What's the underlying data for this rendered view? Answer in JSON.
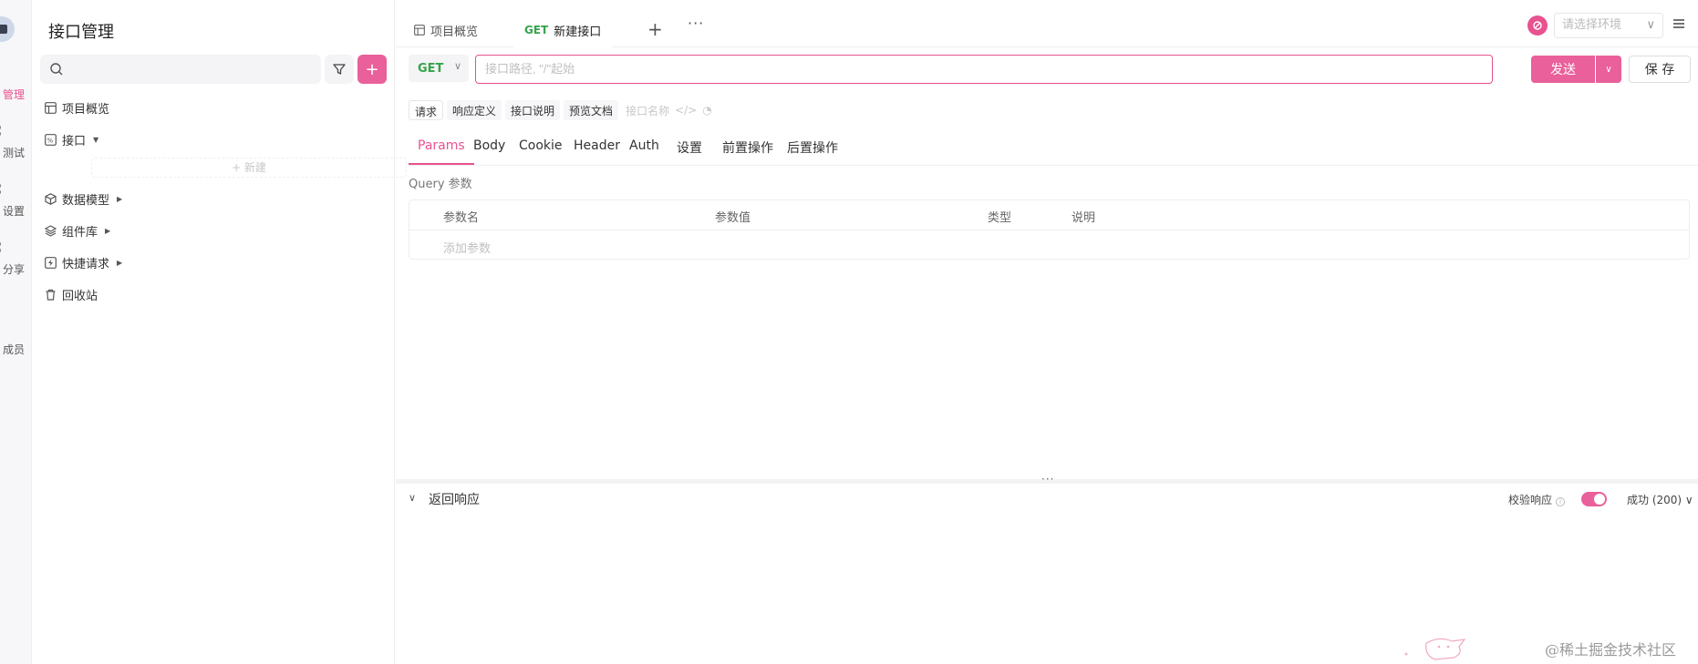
{
  "rail": {
    "items": [
      {
        "label": "管理",
        "icon": "api-icon"
      },
      {
        "label": "测试",
        "icon": "test-icon"
      },
      {
        "label": "设置",
        "icon": "settings-icon"
      },
      {
        "label": "分享",
        "icon": "share-icon"
      },
      {
        "label": "成员",
        "icon": "members-icon"
      }
    ]
  },
  "sidebar": {
    "title": "接口管理",
    "search_placeholder": "",
    "new_label": "+ 新建",
    "items": [
      {
        "label": "项目概览",
        "icon": "overview-icon"
      },
      {
        "label": "接口",
        "icon": "api-folder-icon",
        "expandable": true
      },
      {
        "label": "数据模型",
        "icon": "model-icon",
        "expandable": true
      },
      {
        "label": "组件库",
        "icon": "layers-icon",
        "expandable": true
      },
      {
        "label": "快捷请求",
        "icon": "quick-request-icon",
        "expandable": true
      },
      {
        "label": "回收站",
        "icon": "trash-icon"
      }
    ]
  },
  "tabs": {
    "items": [
      {
        "label": "项目概览",
        "active": false
      },
      {
        "method": "GET",
        "label": "新建接口",
        "active": true
      }
    ],
    "plus": "+",
    "more": "···"
  },
  "env": {
    "placeholder": "请选择环境"
  },
  "request": {
    "method": "GET",
    "url_placeholder": "接口路径, \"/\"起始",
    "send_label": "发送",
    "save_label": "保 存"
  },
  "subtabs": {
    "items": [
      "请求",
      "响应定义",
      "接口说明",
      "预览文档"
    ],
    "name_placeholder": "接口名称"
  },
  "request_tabs": [
    "Params",
    "Body",
    "Cookie",
    "Header",
    "Auth",
    "设置",
    "前置操作",
    "后置操作"
  ],
  "params": {
    "section_label": "Query 参数",
    "columns": [
      "参数名",
      "参数值",
      "类型",
      "说明"
    ],
    "add_placeholder": "添加参数"
  },
  "response": {
    "title": "返回响应",
    "verify_label": "校验响应",
    "verify_on": true,
    "status": "成功 (200)"
  },
  "watermark": "@稀土掘金技术社区",
  "colors": {
    "accent": "#e9609a",
    "get_method": "#35a44a"
  }
}
